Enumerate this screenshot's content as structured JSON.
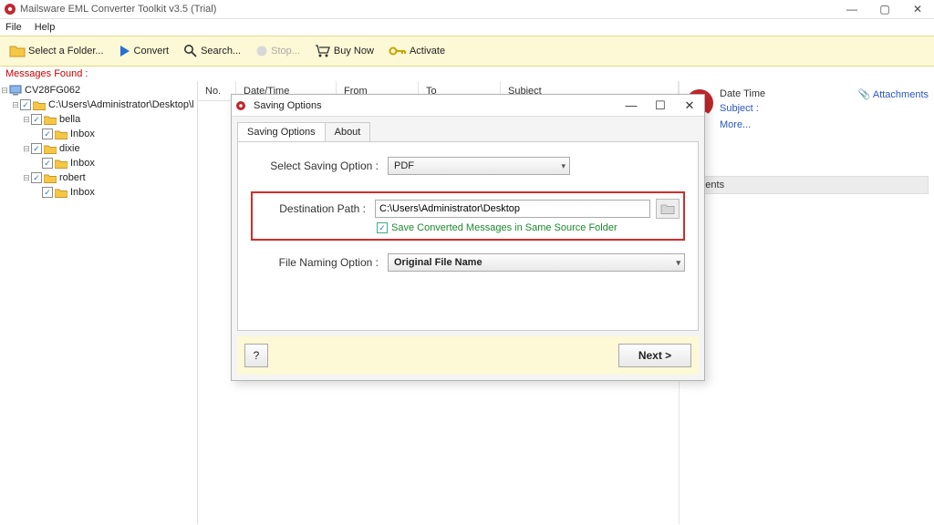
{
  "window": {
    "title": "Mailsware EML Converter Toolkit v3.5 (Trial)",
    "min": "—",
    "max": "▢",
    "close": "✕"
  },
  "menu": {
    "file": "File",
    "help": "Help"
  },
  "toolbar": {
    "select_folder": "Select a Folder...",
    "convert": "Convert",
    "search": "Search...",
    "stop": "Stop...",
    "buy": "Buy Now",
    "activate": "Activate"
  },
  "messages_found": "Messages Found :",
  "tree": {
    "root": "CV28FG062",
    "path": "C:\\Users\\Administrator\\Desktop\\l",
    "folders": [
      {
        "name": "bella",
        "sub": "Inbox"
      },
      {
        "name": "dixie",
        "sub": "Inbox"
      },
      {
        "name": "robert",
        "sub": "Inbox"
      }
    ]
  },
  "columns": {
    "no": "No.",
    "dt": "Date/Time",
    "from": "From",
    "to": "To",
    "subject": "Subject"
  },
  "rightpanel": {
    "datetime": "Date Time",
    "subject": "Subject :",
    "more": "More...",
    "attachments_icon": "📎",
    "attachments": "Attachments",
    "sect": "hments"
  },
  "dialog": {
    "title": "Saving Options",
    "tab_saving": "Saving Options",
    "tab_about": "About",
    "lbl_select": "Select Saving Option  :",
    "sel_value": "PDF",
    "lbl_dest": "Destination Path  :",
    "dest_value": "C:\\Users\\Administrator\\Desktop",
    "chk_same": "Save Converted Messages in Same Source Folder",
    "lbl_naming": "File Naming Option  :",
    "naming_value": "Original File Name",
    "help": "?",
    "next": "Next >",
    "min": "—",
    "max": "☐",
    "close": "✕"
  }
}
